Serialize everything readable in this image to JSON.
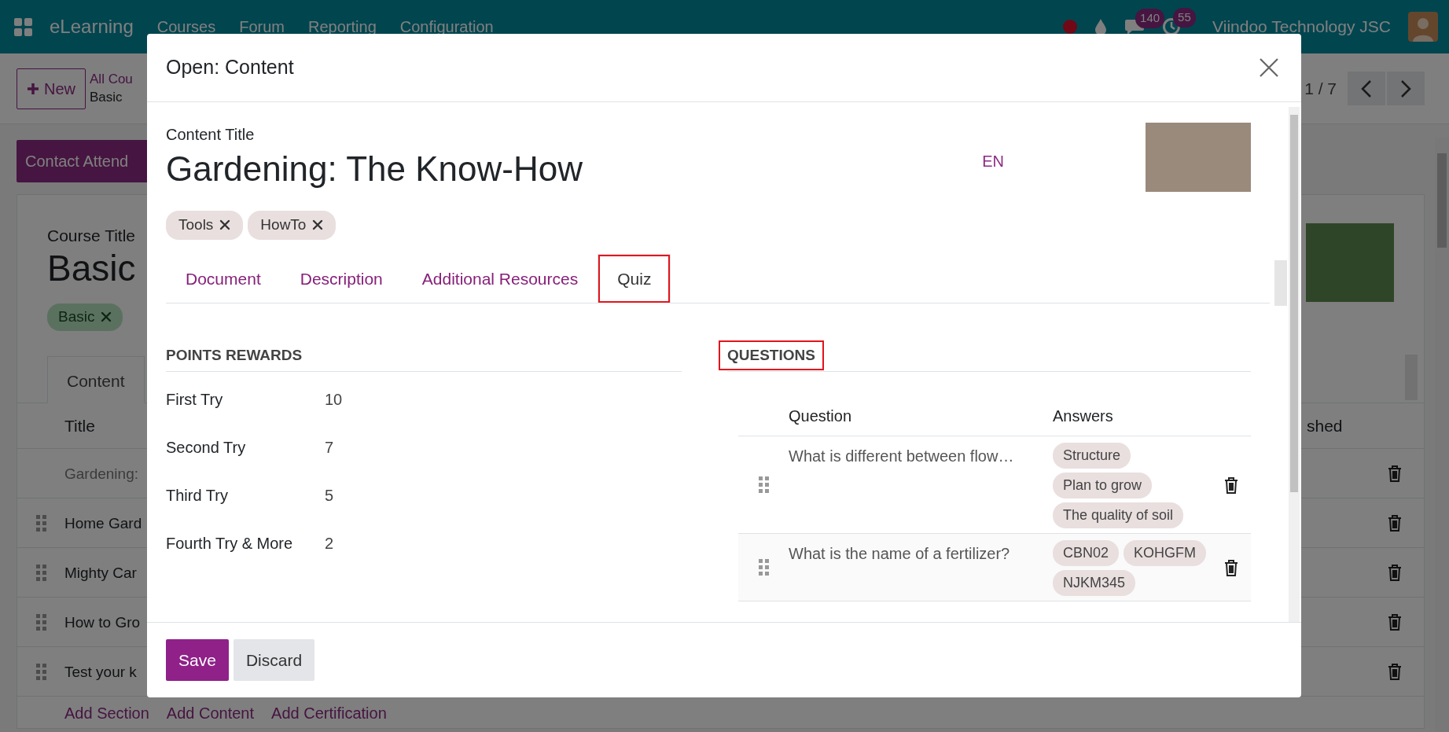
{
  "navbar": {
    "app_name": "eLearning",
    "menu": [
      "Courses",
      "Forum",
      "Reporting",
      "Configuration"
    ],
    "message_count": "140",
    "activity_count": "55",
    "company": "Viindoo Technology JSC"
  },
  "control_panel": {
    "new_button": "New",
    "breadcrumb": [
      "All Cou",
      "Basic"
    ],
    "pager": "1 / 7"
  },
  "course": {
    "contact_button": "Contact Attend",
    "title_label": "Course Title",
    "title": "Basic",
    "tags": [
      "Basic"
    ],
    "tabs": [
      {
        "label": "Content",
        "selected": true
      }
    ],
    "table": {
      "columns": [
        "Title",
        "shed"
      ],
      "rows": [
        {
          "title": "Gardening:",
          "draggable": false,
          "muted": true
        },
        {
          "title": "Home Gard",
          "draggable": true,
          "muted": false
        },
        {
          "title": "Mighty Car",
          "draggable": true,
          "muted": false
        },
        {
          "title": "How to Gro",
          "draggable": true,
          "muted": false
        },
        {
          "title": "Test your k",
          "draggable": true,
          "muted": false
        }
      ]
    },
    "add_links": [
      "Add Section",
      "Add Content",
      "Add Certification"
    ]
  },
  "dialog": {
    "title": "Open: Content",
    "content_title_label": "Content Title",
    "content_title": "Gardening: The Know-How",
    "language": "EN",
    "tags": [
      "Tools",
      "HowTo"
    ],
    "tabs": [
      {
        "label": "Document",
        "selected": false,
        "highlighted": false
      },
      {
        "label": "Description",
        "selected": false,
        "highlighted": false
      },
      {
        "label": "Additional Resources",
        "selected": false,
        "highlighted": false
      },
      {
        "label": "Quiz",
        "selected": true,
        "highlighted": true
      }
    ],
    "points": {
      "title": "POINTS REWARDS",
      "highlighted": false,
      "fields": [
        {
          "label": "First Try",
          "value": "10"
        },
        {
          "label": "Second Try",
          "value": "7"
        },
        {
          "label": "Third Try",
          "value": "5"
        },
        {
          "label": "Fourth Try & More",
          "value": "2"
        }
      ]
    },
    "questions": {
      "title": "QUESTIONS",
      "highlighted": true,
      "columns": [
        "Question",
        "Answers"
      ],
      "rows": [
        {
          "question": "What is different between flow…",
          "answers": [
            "Structure",
            "Plan to grow",
            "The quality of soil"
          ]
        },
        {
          "question": "What is the name of a fertilizer?",
          "answers": [
            "CBN02",
            "KOHGFM",
            "NJKM345"
          ]
        }
      ]
    },
    "buttons": [
      {
        "label": "Save",
        "kind": "primary"
      },
      {
        "label": "Discard",
        "kind": "secondary"
      }
    ]
  }
}
